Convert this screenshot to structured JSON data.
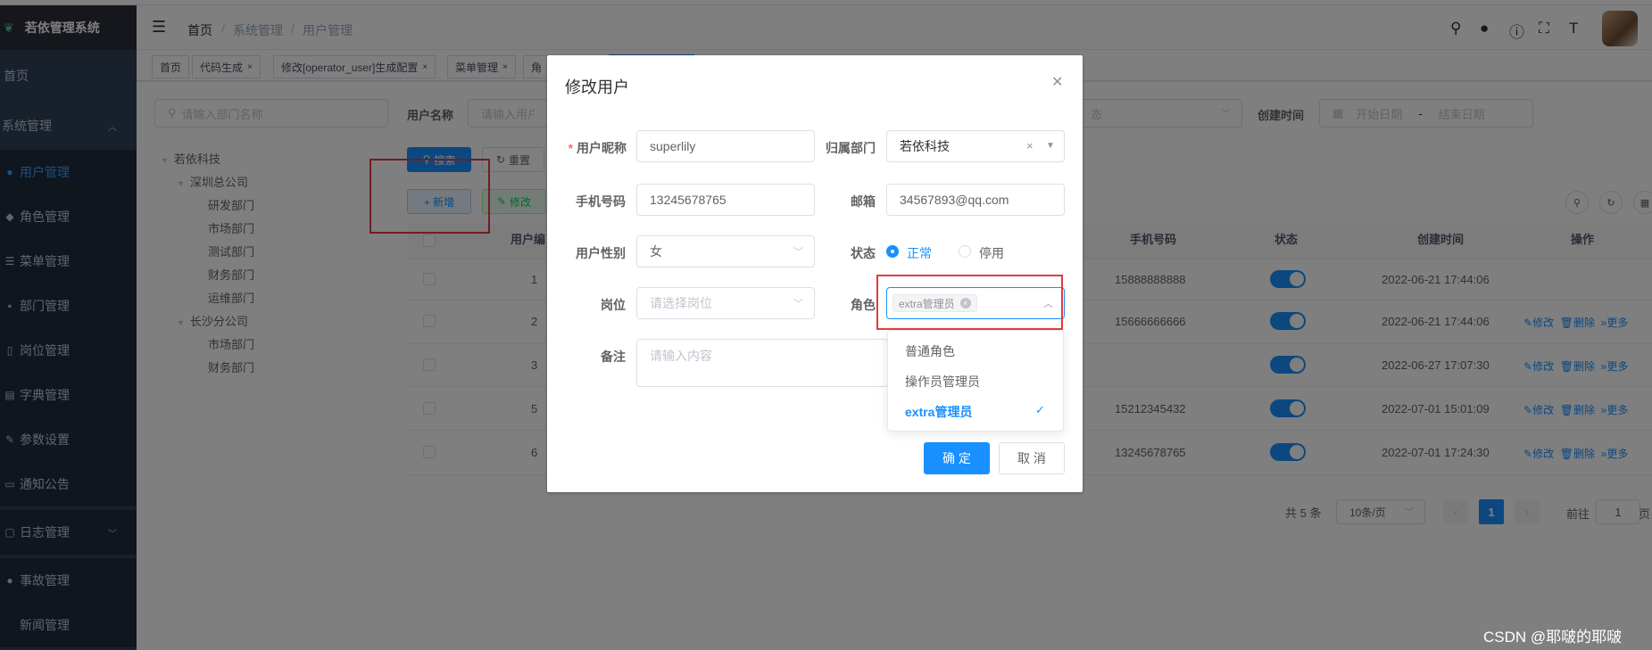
{
  "app": {
    "title": "若依管理系统"
  },
  "sidebar": {
    "items": [
      {
        "label": "首页"
      },
      {
        "label": "系统管理"
      },
      {
        "label": "用户管理"
      },
      {
        "label": "角色管理"
      },
      {
        "label": "菜单管理"
      },
      {
        "label": "部门管理"
      },
      {
        "label": "岗位管理"
      },
      {
        "label": "字典管理"
      },
      {
        "label": "参数设置"
      },
      {
        "label": "通知公告"
      },
      {
        "label": "日志管理"
      },
      {
        "label": "事故管理"
      },
      {
        "label": "新闻管理"
      }
    ]
  },
  "breadcrumb": {
    "home": "首页",
    "sep": "/",
    "level1": "系统管理",
    "level2": "用户管理"
  },
  "tags": [
    {
      "label": "首页"
    },
    {
      "label": "代码生成"
    },
    {
      "label": "修改[operator_user]生成配置"
    },
    {
      "label": "菜单管理"
    },
    {
      "label": "角"
    }
  ],
  "search": {
    "dept_placeholder": "请输入部门名称",
    "username_label": "用户名称",
    "username_placeholder": "请输入用户名",
    "status_placeholder": "态",
    "create_time_label": "创建时间",
    "start_placeholder": "开始日期",
    "range_sep": "-",
    "end_placeholder": "结束日期",
    "search_btn": "搜索",
    "reset_btn": "重置",
    "add_btn": "+ 新增",
    "edit_btn": "修改"
  },
  "tree": [
    {
      "label": "若依科技"
    },
    {
      "label": "深圳总公司"
    },
    {
      "label": "研发部门"
    },
    {
      "label": "市场部门"
    },
    {
      "label": "测试部门"
    },
    {
      "label": "财务部门"
    },
    {
      "label": "运维部门"
    },
    {
      "label": "长沙分公司"
    },
    {
      "label": "市场部门"
    },
    {
      "label": "财务部门"
    }
  ],
  "table": {
    "headers": {
      "id": "用户编",
      "phone": "手机号码",
      "status": "状态",
      "created": "创建时间",
      "ops": "操作"
    },
    "rows": [
      {
        "id": "1",
        "phone": "15888888888",
        "created": "2022-06-21 17:44:06"
      },
      {
        "id": "2",
        "phone": "15666666666",
        "created": "2022-06-21 17:44:06"
      },
      {
        "id": "3",
        "phone": "",
        "created": "2022-06-27 17:07:30"
      },
      {
        "id": "5",
        "phone": "15212345432",
        "created": "2022-07-01 15:01:09"
      },
      {
        "id": "6",
        "phone": "13245678765",
        "created": "2022-07-01 17:24:30"
      }
    ],
    "op_edit": "修改",
    "op_delete": "删除",
    "op_more": "更多"
  },
  "pagination": {
    "total": "共 5 条",
    "page_size": "10条/页",
    "current": "1",
    "goto_label": "前往",
    "goto_value": "1",
    "page_suffix": "页"
  },
  "dialog": {
    "title": "修改用户",
    "nickname_label": "用户昵称",
    "nickname_value": "superlily",
    "dept_label": "归属部门",
    "dept_value": "若依科技",
    "phone_label": "手机号码",
    "phone_value": "13245678765",
    "email_label": "邮箱",
    "email_value": "34567893@qq.com",
    "gender_label": "用户性别",
    "gender_value": "女",
    "status_label": "状态",
    "status_normal": "正常",
    "status_disabled": "停用",
    "post_label": "岗位",
    "post_placeholder": "请选择岗位",
    "role_label": "角色",
    "role_chip": "extra管理员",
    "remark_label": "备注",
    "remark_placeholder": "请输入内容",
    "confirm_btn": "确 定",
    "cancel_btn": "取 消",
    "role_options": [
      {
        "label": "普通角色"
      },
      {
        "label": "操作员管理员"
      },
      {
        "label": "extra管理员"
      }
    ]
  },
  "watermark": "CSDN @耶啵的耶啵",
  "colors": {
    "primary": "#1890ff",
    "sidebar": "#304156",
    "highlight": "#e8393a"
  }
}
